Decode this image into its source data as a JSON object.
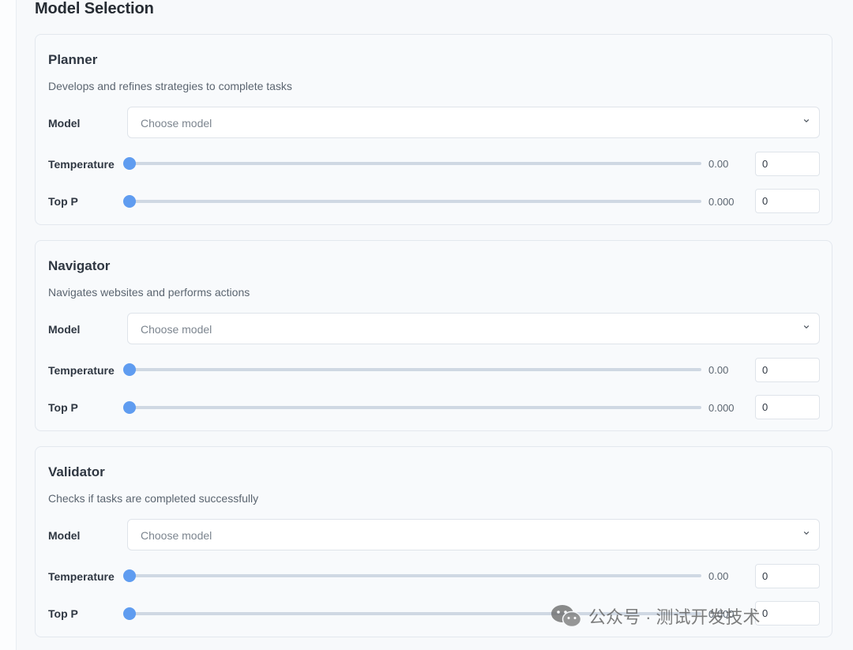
{
  "page": {
    "title": "Model Selection"
  },
  "cards": [
    {
      "title": "Planner",
      "description": "Develops and refines strategies to complete tasks",
      "model": {
        "label": "Model",
        "placeholder": "Choose model"
      },
      "temperature": {
        "label": "Temperature",
        "value": 0,
        "display": "0.00",
        "input": "0"
      },
      "top_p": {
        "label": "Top P",
        "value": 0,
        "display": "0.000",
        "input": "0"
      }
    },
    {
      "title": "Navigator",
      "description": "Navigates websites and performs actions",
      "model": {
        "label": "Model",
        "placeholder": "Choose model"
      },
      "temperature": {
        "label": "Temperature",
        "value": 0,
        "display": "0.00",
        "input": "0"
      },
      "top_p": {
        "label": "Top P",
        "value": 0,
        "display": "0.000",
        "input": "0"
      }
    },
    {
      "title": "Validator",
      "description": "Checks if tasks are completed successfully",
      "model": {
        "label": "Model",
        "placeholder": "Choose model"
      },
      "temperature": {
        "label": "Temperature",
        "value": 0,
        "display": "0.00",
        "input": "0"
      },
      "top_p": {
        "label": "Top P",
        "value": 0,
        "display": "0.000",
        "input": "0"
      }
    }
  ],
  "watermark": {
    "text": "公众号 · 测试开发技术",
    "icon": "wechat-icon"
  },
  "colors": {
    "accent": "#5f9cf0",
    "track": "#cfd8e3"
  }
}
